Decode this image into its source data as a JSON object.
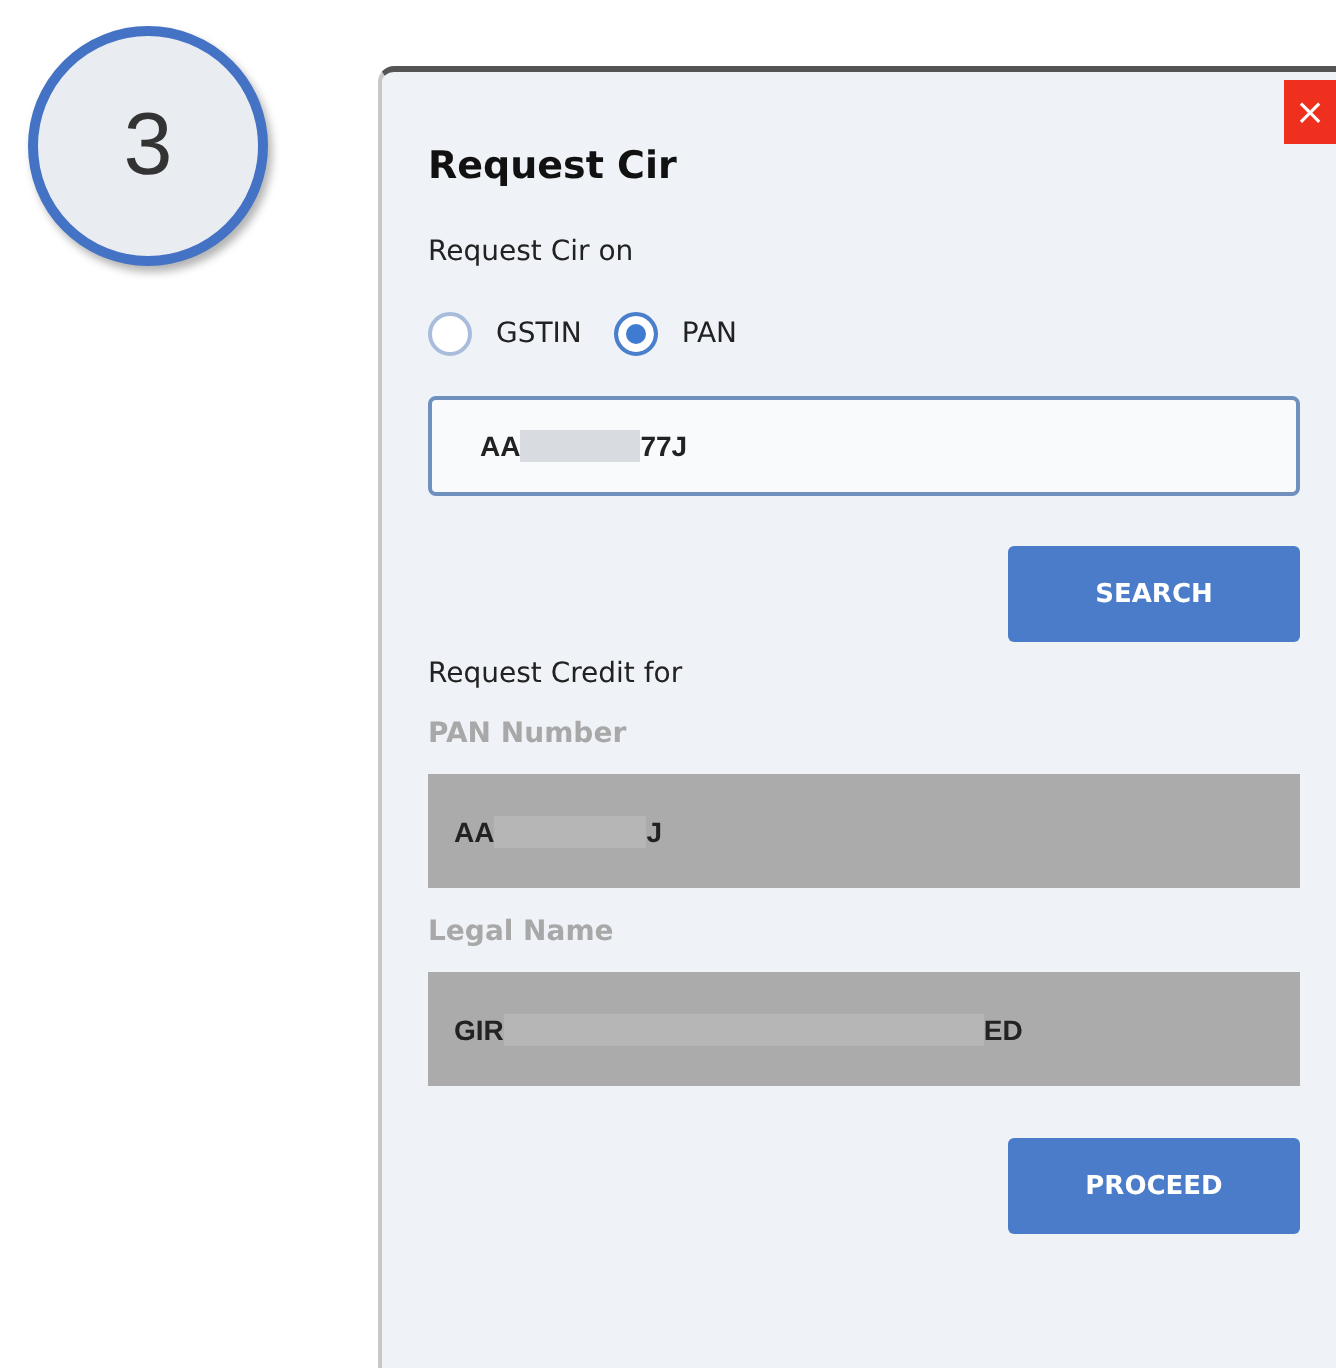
{
  "step_badge": {
    "label": "3"
  },
  "dialog": {
    "title": "Request Cir",
    "close": "×",
    "request_on": {
      "label": "Request Cir on",
      "options": [
        {
          "label": "GSTIN",
          "selected": false
        },
        {
          "label": "PAN",
          "selected": true
        }
      ]
    },
    "search_field": {
      "value_start": "AA",
      "value_end": "77J"
    },
    "search_button": "SEARCH",
    "credit_section": {
      "label": "Request Credit for",
      "fields": [
        {
          "label": "PAN Number",
          "value_start": "AA",
          "value_end": "J"
        },
        {
          "label": "Legal Name",
          "value_start": "GIR",
          "value_end": "ED"
        }
      ]
    },
    "proceed_button": "PROCEED"
  }
}
